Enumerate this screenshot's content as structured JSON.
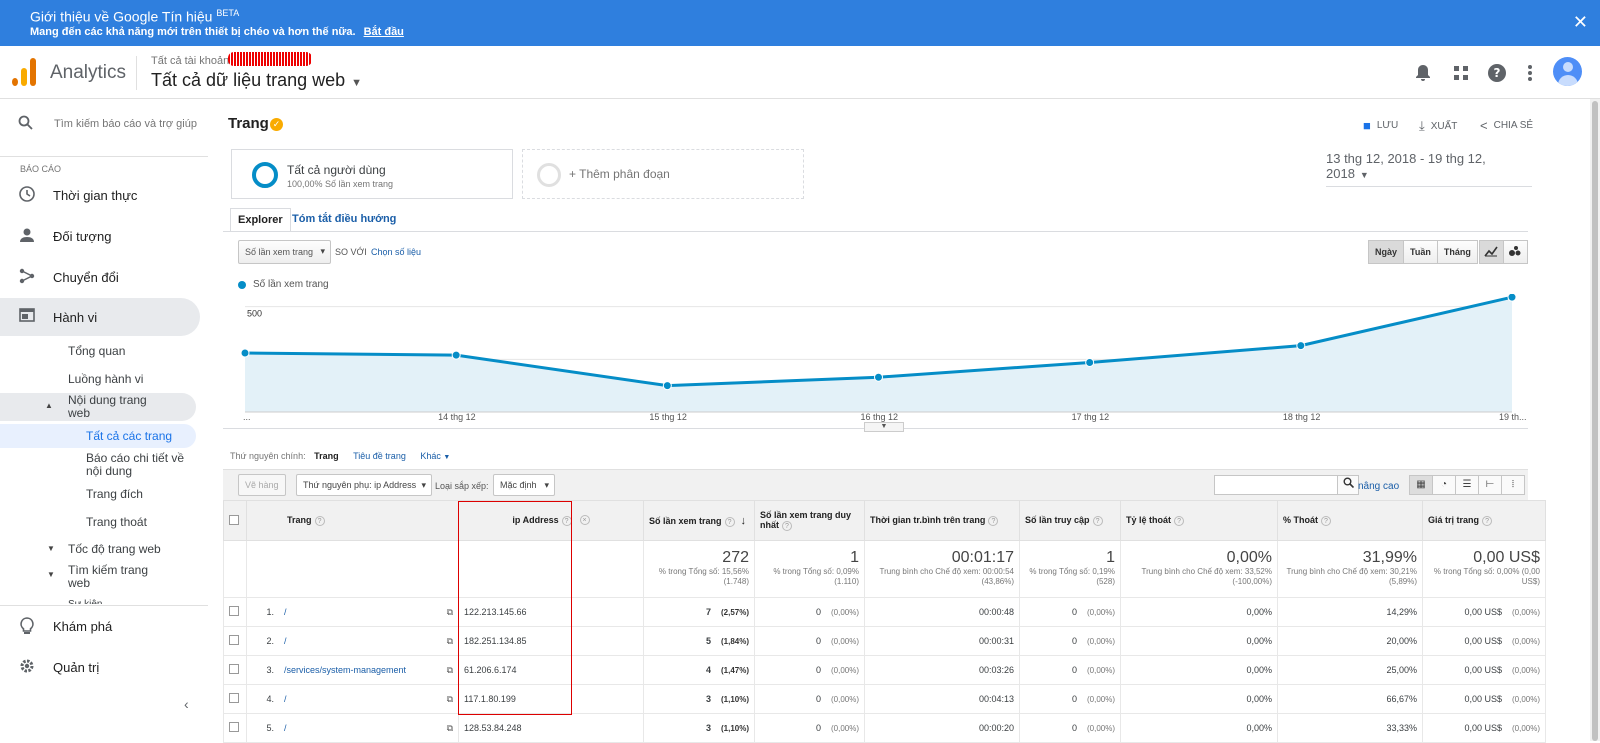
{
  "banner": {
    "title": "Giới thiệu về Google Tín hiệu",
    "badge": "BETA",
    "subtitle": "Mang đến các khả năng mới trên thiết bị chéo và hơn thế nữa.",
    "link": "Bắt đầu",
    "close": "✕"
  },
  "header": {
    "app_name": "Analytics",
    "account_small": "Tất cả tài khoản",
    "account_sep": ">",
    "property": "Tất cả dữ liệu trang web"
  },
  "sidebar": {
    "search_placeholder": "Tìm kiếm báo cáo và trợ giúp",
    "section_label": "BÁO CÁO",
    "items": [
      {
        "label": "Thời gian thực",
        "icon": "clock-icon"
      },
      {
        "label": "Đối tượng",
        "icon": "person-icon"
      },
      {
        "label": "Chuyển đổi",
        "icon": "conversions-icon"
      },
      {
        "label": "Hành vi",
        "icon": "behavior-icon"
      }
    ],
    "sub": {
      "tong_quan": "Tổng quan",
      "luong": "Luồng hành vi",
      "noi_dung": "Nội dung trang web",
      "tat_ca": "Tất cả các trang",
      "bao_cao": "Báo cáo chi tiết về nội dung",
      "trang_dich": "Trang đích",
      "trang_thoat": "Trang thoát",
      "toc_do": "Tốc độ trang web",
      "tim_kiem": "Tìm kiếm trang web",
      "cut": "Sự kiện"
    },
    "kham_pha": "Khám phá",
    "quan_tri": "Quản trị",
    "collapse": "‹"
  },
  "page": {
    "title": "Trang",
    "actions": {
      "save": "LƯU",
      "export": "XUẤT",
      "share": "CHIA SẺ"
    },
    "segment1_name": "Tất cả người dùng",
    "segment1_sub": "100,00% Số lần xem trang",
    "segment2": "+ Thêm phân đoạn",
    "date_range": "13 thg 12, 2018 - 19 thg 12, 2018",
    "tabs": [
      "Explorer",
      "Tóm tắt điều hướng"
    ],
    "metric_select": "Số lần xem trang",
    "so_voi": "SO VỚI",
    "chon_so_lieu": "Chọn số liệu",
    "periods": [
      "Ngày",
      "Tuần",
      "Tháng"
    ],
    "legend": "Số lần xem trang"
  },
  "chart_data": {
    "type": "line",
    "series": [
      {
        "name": "Số lần xem trang",
        "values": [
          280,
          270,
          125,
          165,
          235,
          315,
          545
        ]
      }
    ],
    "x": [
      "13 thg 12",
      "14 thg 12",
      "15 thg 12",
      "16 thg 12",
      "17 thg 12",
      "18 thg 12",
      "19 thg 12"
    ],
    "x_tick_labels": [
      "...",
      "14 thg 12",
      "15 thg 12",
      "16 thg 12",
      "17 thg 12",
      "18 thg 12",
      "19 th..."
    ],
    "y_ticks": [
      500,
      250
    ],
    "ylim": [
      0,
      560
    ],
    "color": "#058dc7",
    "grid": true
  },
  "dims": {
    "label": "Thứ nguyên chính:",
    "primary": "Trang",
    "title": "Tiêu đề trang",
    "other": "Khác"
  },
  "toolbar": {
    "ve_hang": "Vẽ hàng",
    "secondary": "Thứ nguyên phụ: ip Address",
    "sort_label": "Loại sắp xếp:",
    "sort_value": "Mặc định",
    "advanced": "nâng cao"
  },
  "table": {
    "headers": [
      "Trang",
      "ip Address",
      "Số lần xem trang",
      "Số lần xem trang duy nhất",
      "Thời gian tr.bình trên trang",
      "Số lần truy cập",
      "Tỷ lệ thoát",
      "% Thoát",
      "Giá trị trang"
    ],
    "totals": [
      {
        "value": "272",
        "sub": "% trong Tổng số: 15,56% (1.748)"
      },
      {
        "value": "1",
        "sub": "% trong Tổng số: 0,09% (1.110)"
      },
      {
        "value": "00:01:17",
        "sub": "Trung bình cho Chế độ xem: 00:00:54 (43,86%)"
      },
      {
        "value": "1",
        "sub": "% trong Tổng số: 0,19% (528)"
      },
      {
        "value": "0,00%",
        "sub": "Trung bình cho Chế độ xem: 33,52% (-100,00%)"
      },
      {
        "value": "31,99%",
        "sub": "Trung bình cho Chế độ xem: 30,21% (5,89%)"
      },
      {
        "value": "0,00 US$",
        "sub": "% trong Tổng số: 0,00% (0,00 US$)"
      }
    ],
    "rows": [
      {
        "n": "1.",
        "page": "/",
        "ip": "122.213.145.66",
        "views": "7",
        "views_pct": "(2,57%)",
        "uniq": "0",
        "uniq_pct": "(0,00%)",
        "time": "00:00:48",
        "ent": "0",
        "ent_pct": "(0,00%)",
        "bounce": "0,00%",
        "exit": "14,29%",
        "val": "0,00 US$",
        "val_pct": "(0,00%)"
      },
      {
        "n": "2.",
        "page": "/",
        "ip": "182.251.134.85",
        "views": "5",
        "views_pct": "(1,84%)",
        "uniq": "0",
        "uniq_pct": "(0,00%)",
        "time": "00:00:31",
        "ent": "0",
        "ent_pct": "(0,00%)",
        "bounce": "0,00%",
        "exit": "20,00%",
        "val": "0,00 US$",
        "val_pct": "(0,00%)"
      },
      {
        "n": "3.",
        "page": "/services/system-management",
        "ip": "61.206.6.174",
        "views": "4",
        "views_pct": "(1,47%)",
        "uniq": "0",
        "uniq_pct": "(0,00%)",
        "time": "00:03:26",
        "ent": "0",
        "ent_pct": "(0,00%)",
        "bounce": "0,00%",
        "exit": "25,00%",
        "val": "0,00 US$",
        "val_pct": "(0,00%)"
      },
      {
        "n": "4.",
        "page": "/",
        "ip": "117.1.80.199",
        "views": "3",
        "views_pct": "(1,10%)",
        "uniq": "0",
        "uniq_pct": "(0,00%)",
        "time": "00:04:13",
        "ent": "0",
        "ent_pct": "(0,00%)",
        "bounce": "0,00%",
        "exit": "66,67%",
        "val": "0,00 US$",
        "val_pct": "(0,00%)"
      },
      {
        "n": "5.",
        "page": "/",
        "ip": "128.53.84.248",
        "views": "3",
        "views_pct": "(1,10%)",
        "uniq": "0",
        "uniq_pct": "(0,00%)",
        "time": "00:00:20",
        "ent": "0",
        "ent_pct": "(0,00%)",
        "bounce": "0,00%",
        "exit": "33,33%",
        "val": "0,00 US$",
        "val_pct": "(0,00%)"
      }
    ]
  }
}
